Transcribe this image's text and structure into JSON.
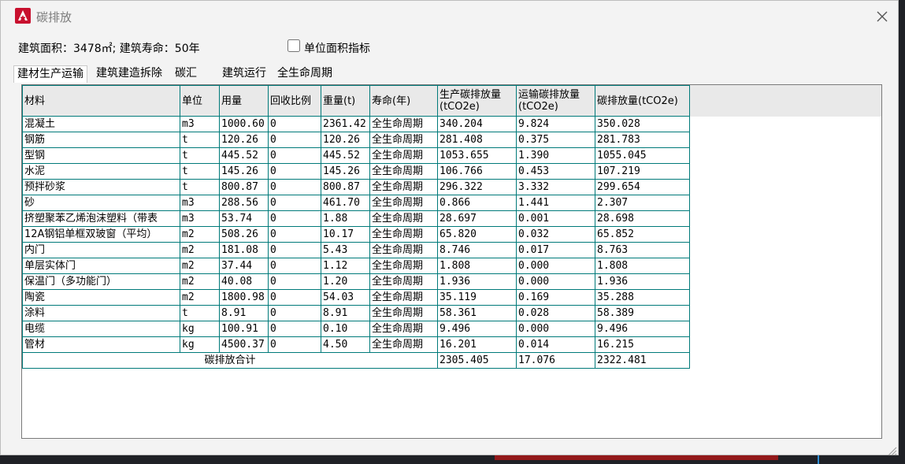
{
  "window": {
    "title": "碳排放",
    "close_icon": "close-icon",
    "app_icon": "autocad-icon"
  },
  "info": {
    "text": "建筑面积：3478㎡; 建筑寿命：50年",
    "checkbox_label": "单位面积指标",
    "checkbox_checked": false
  },
  "tabs": [
    {
      "label": "建材生产运输",
      "active": true
    },
    {
      "label": "建筑建造拆除",
      "active": false
    },
    {
      "label": "碳汇",
      "active": false
    },
    {
      "label": "建筑运行",
      "active": false
    },
    {
      "label": "全生命周期",
      "active": false
    }
  ],
  "table": {
    "columns": [
      "材料",
      "单位",
      "用量",
      "回收比例",
      "重量(t)",
      "寿命(年)",
      "生产碳排放量(tCO2e)",
      "运输碳排放量(tCO2e)",
      "碳排放量(tCO2e)"
    ],
    "rows": [
      [
        "混凝土",
        "m3",
        "1000.60",
        "0",
        "2361.42",
        "全生命周期",
        "340.204",
        "9.824",
        "350.028"
      ],
      [
        "钢筋",
        "t",
        "120.26",
        "0",
        "120.26",
        "全生命周期",
        "281.408",
        "0.375",
        "281.783"
      ],
      [
        "型钢",
        "t",
        "445.52",
        "0",
        "445.52",
        "全生命周期",
        "1053.655",
        "1.390",
        "1055.045"
      ],
      [
        "水泥",
        "t",
        "145.26",
        "0",
        "145.26",
        "全生命周期",
        "106.766",
        "0.453",
        "107.219"
      ],
      [
        "预拌砂浆",
        "t",
        "800.87",
        "0",
        "800.87",
        "全生命周期",
        "296.322",
        "3.332",
        "299.654"
      ],
      [
        "砂",
        "m3",
        "288.56",
        "0",
        "461.70",
        "全生命周期",
        "0.866",
        "1.441",
        "2.307"
      ],
      [
        "挤塑聚苯乙烯泡沫塑料（带表",
        "m3",
        "53.74",
        "0",
        "1.88",
        "全生命周期",
        "28.697",
        "0.001",
        "28.698"
      ],
      [
        "12A钢铝单框双玻窗（平均）",
        "m2",
        "508.26",
        "0",
        "10.17",
        "全生命周期",
        "65.820",
        "0.032",
        "65.852"
      ],
      [
        "内门",
        "m2",
        "181.08",
        "0",
        "5.43",
        "全生命周期",
        "8.746",
        "0.017",
        "8.763"
      ],
      [
        "单层实体门",
        "m2",
        "37.44",
        "0",
        "1.12",
        "全生命周期",
        "1.808",
        "0.000",
        "1.808"
      ],
      [
        "保温门（多功能门）",
        "m2",
        "40.08",
        "0",
        "1.20",
        "全生命周期",
        "1.936",
        "0.000",
        "1.936"
      ],
      [
        "陶瓷",
        "m2",
        "1800.98",
        "0",
        "54.03",
        "全生命周期",
        "35.119",
        "0.169",
        "35.288"
      ],
      [
        "涂料",
        "t",
        "8.91",
        "0",
        "8.91",
        "全生命周期",
        "58.361",
        "0.028",
        "58.389"
      ],
      [
        "电缆",
        "kg",
        "100.91",
        "0",
        "0.10",
        "全生命周期",
        "9.496",
        "0.000",
        "9.496"
      ],
      [
        "管材",
        "kg",
        "4500.37",
        "0",
        "4.50",
        "全生命周期",
        "16.201",
        "0.014",
        "16.215"
      ]
    ],
    "total": {
      "label": "碳排放合计",
      "production": "2305.405",
      "transport": "17.076",
      "sum": "2322.481"
    }
  }
}
